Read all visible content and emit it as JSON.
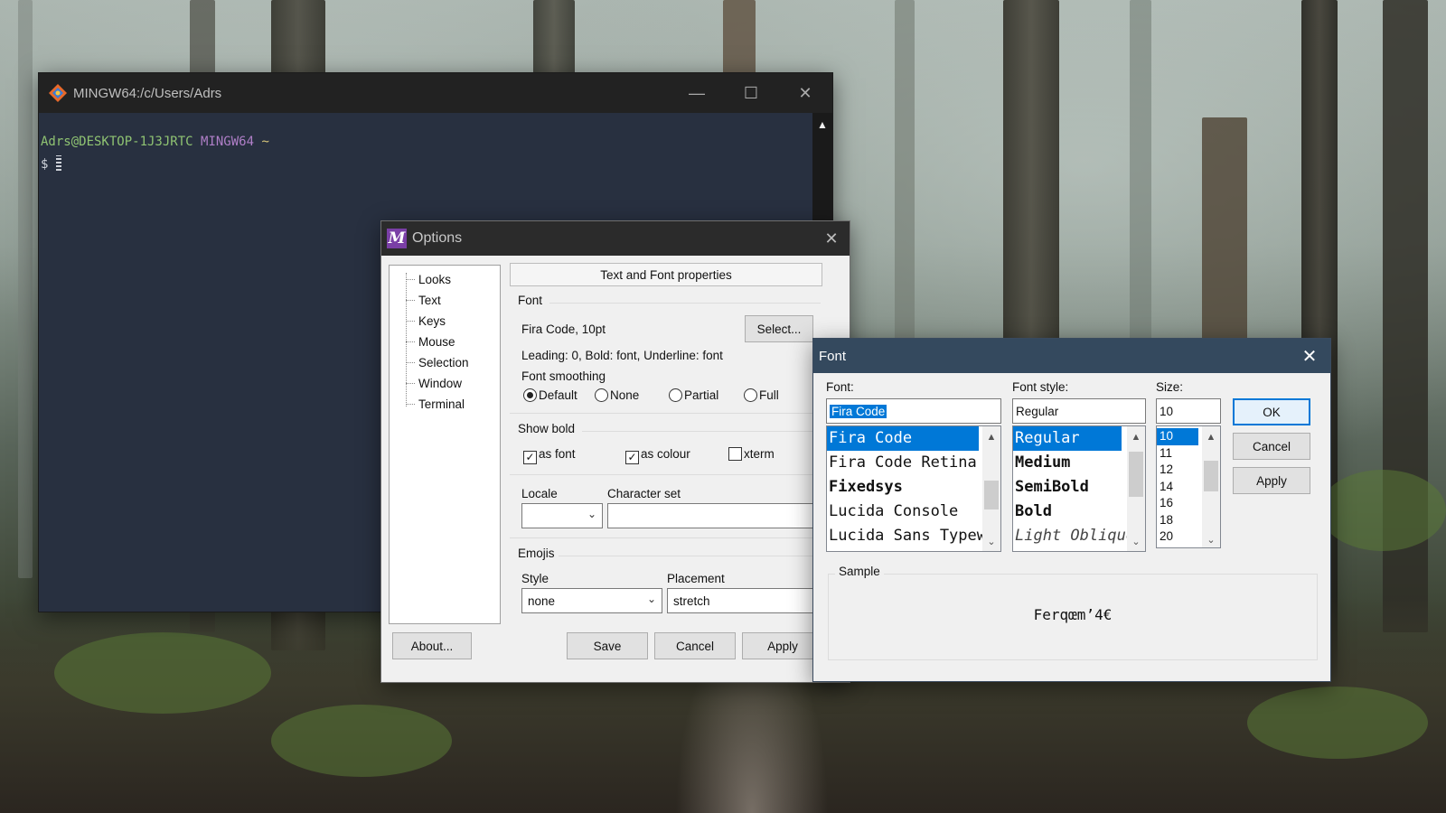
{
  "terminal": {
    "title": "MINGW64:/c/Users/Adrs",
    "controls": {
      "minimize": "—",
      "maximize": "☐",
      "close": "✕"
    },
    "prompt_user_host": "Adrs@DESKTOP-1J3JRTC",
    "prompt_env": "MINGW64",
    "prompt_path": "~",
    "prompt_symbol": "$"
  },
  "options": {
    "title": "Options",
    "close": "✕",
    "tree": [
      "Looks",
      "Text",
      "Keys",
      "Mouse",
      "Selection",
      "Window",
      "Terminal"
    ],
    "header": "Text and Font properties",
    "font_section": "Font",
    "font_value": "Fira Code, 10pt",
    "select_button": "Select...",
    "font_info": "Leading: 0, Bold: font, Underline: font",
    "smoothing_label": "Font smoothing",
    "smoothing_options": [
      "Default",
      "None",
      "Partial",
      "Full"
    ],
    "smoothing_selected": "Default",
    "show_bold_section": "Show bold",
    "bold_options": [
      {
        "label": "as font",
        "checked": true
      },
      {
        "label": "as colour",
        "checked": true
      },
      {
        "label": "xterm",
        "checked": false
      }
    ],
    "locale_label": "Locale",
    "locale_value": "",
    "charset_label": "Character set",
    "charset_value": "",
    "emojis_section": "Emojis",
    "style_label": "Style",
    "style_value": "none",
    "placement_label": "Placement",
    "placement_value": "stretch",
    "buttons": {
      "about": "About...",
      "save": "Save",
      "cancel": "Cancel",
      "apply": "Apply"
    }
  },
  "font_dialog": {
    "title": "Font",
    "close": "✕",
    "font_label": "Font:",
    "font_input": "Fira Code",
    "font_list": [
      "Fira Code",
      "Fira Code Retina",
      "Fixedsys",
      "Lucida Console",
      "Lucida Sans Typewriter"
    ],
    "font_selected": "Fira Code",
    "style_label": "Font style:",
    "style_input": "Regular",
    "style_list": [
      "Regular",
      "Medium",
      "SemiBold",
      "Bold",
      "Light Oblique"
    ],
    "style_selected": "Regular",
    "size_label": "Size:",
    "size_input": "10",
    "size_list": [
      "10",
      "11",
      "12",
      "14",
      "16",
      "18",
      "20"
    ],
    "size_selected": "10",
    "buttons": {
      "ok": "OK",
      "cancel": "Cancel",
      "apply": "Apply"
    },
    "sample_label": "Sample",
    "sample_text": "Ferqœm’4€"
  },
  "colors": {
    "terminal_bg": "#283040",
    "titlebar_dark": "#222222",
    "font_titlebar": "#34495e",
    "selection": "#0078d7",
    "prompt_green": "#8fc372",
    "prompt_purple": "#b07fc8",
    "prompt_yellow": "#d8c67a"
  }
}
